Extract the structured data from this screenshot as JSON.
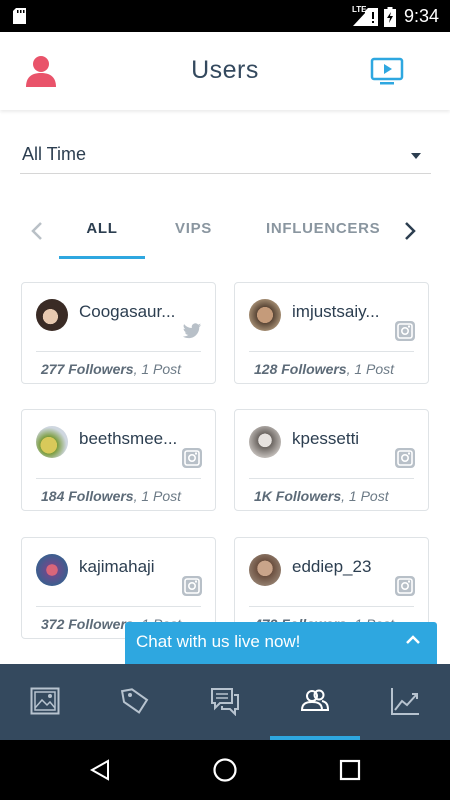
{
  "status_bar": {
    "network": "LTE",
    "time": "9:34"
  },
  "header": {
    "title": "Users",
    "left_icon": "profile-icon",
    "right_icon": "video-icon",
    "accent_color": "#2ea7e0",
    "profile_color": "#e9536a"
  },
  "filter": {
    "selected": "All Time"
  },
  "tabs": {
    "items": [
      "ALL",
      "VIPS",
      "INFLUENCERS"
    ],
    "active": "ALL"
  },
  "users": [
    {
      "name": "Coogasaur...",
      "network": "twitter",
      "followers": "277 Followers",
      "posts": "1 Post"
    },
    {
      "name": "imjustsaiy...",
      "network": "instagram",
      "followers": "128 Followers",
      "posts": "1 Post"
    },
    {
      "name": "beethsmee...",
      "network": "instagram",
      "followers": "184 Followers",
      "posts": "1 Post"
    },
    {
      "name": "kpessetti",
      "network": "instagram",
      "followers": "1K Followers",
      "posts": "1 Post"
    },
    {
      "name": "kajimahaji",
      "network": "instagram",
      "followers": "372 Followers",
      "posts": "1 Post"
    },
    {
      "name": "eddiep_23",
      "network": "instagram",
      "followers": "472 Followers",
      "posts": "1 Post"
    }
  ],
  "chat": {
    "label": "Chat with us live now!"
  },
  "bottom_nav": {
    "items": [
      "image-icon",
      "tag-icon",
      "chat-icon",
      "users-icon",
      "trend-chart-icon"
    ],
    "active": "users-icon"
  }
}
